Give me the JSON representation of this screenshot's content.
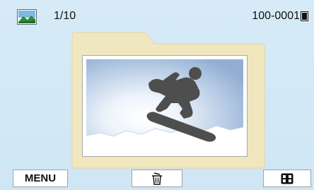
{
  "status": {
    "mode_icon": "landscape-photo-icon",
    "counter": "1/10",
    "file_number": "100-0001",
    "memory_icon": "memory-card-icon"
  },
  "viewer": {
    "folder_icon": "folder-icon",
    "photo_subject": "snowboarder-silhouette-image"
  },
  "bottom_bar": {
    "menu_label": "MENU",
    "delete_icon": "trash-icon",
    "view_icon": "thumbnail-view-icon"
  },
  "colors": {
    "background": "#d6ebf7",
    "folder": "#f1e7be",
    "button_border": "#9aa4ad"
  }
}
